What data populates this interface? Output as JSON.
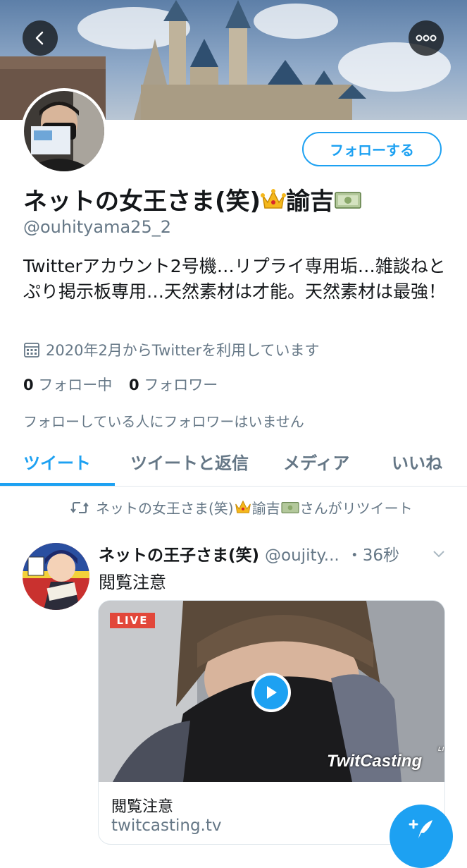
{
  "profile": {
    "follow_label": "フォローする",
    "name": "ネットの女王さま(笑)",
    "name_suffix": "諭吉",
    "handle": "@ouhityama25_2",
    "bio": "Twitterアカウント2号機…リプライ専用垢…雑談ねとぷり掲示板専用…天然素材は才能。天然素材は最強！",
    "joined": "2020年2月からTwitterを利用しています",
    "following_count": "0",
    "following_label": "フォロー中",
    "followers_count": "0",
    "followers_label": "フォロワー",
    "no_mutual_followers": "フォローしている人にフォロワーはいません"
  },
  "tabs": [
    {
      "label": "ツイート",
      "active": true
    },
    {
      "label": "ツイートと返信",
      "active": false
    },
    {
      "label": "メディア",
      "active": false
    },
    {
      "label": "いいね",
      "active": false
    }
  ],
  "tweet": {
    "retweeted_by_name": "ネットの女王さま(笑)",
    "retweeted_by_suffix": "諭吉",
    "retweeted_text": "さんがリツイート",
    "display_name": "ネットの王子さま(笑)",
    "handle": "@oujity...",
    "time": "・36秒",
    "text": "閲覧注意",
    "card": {
      "badge": "LIVE",
      "logo": "TwitCasting",
      "logo_sup": "LIVE",
      "title": "閲覧注意",
      "domain": "twitcasting.tv"
    }
  },
  "icons": [
    "back-arrow-icon",
    "more-icon",
    "calendar-icon",
    "retweet-icon",
    "chevron-down-icon",
    "play-icon",
    "compose-icon",
    "crown-emoji",
    "money-emoji"
  ],
  "colors": {
    "accent": "#1da1f2",
    "secondary_text": "#657786",
    "live_red": "#e2473a"
  }
}
